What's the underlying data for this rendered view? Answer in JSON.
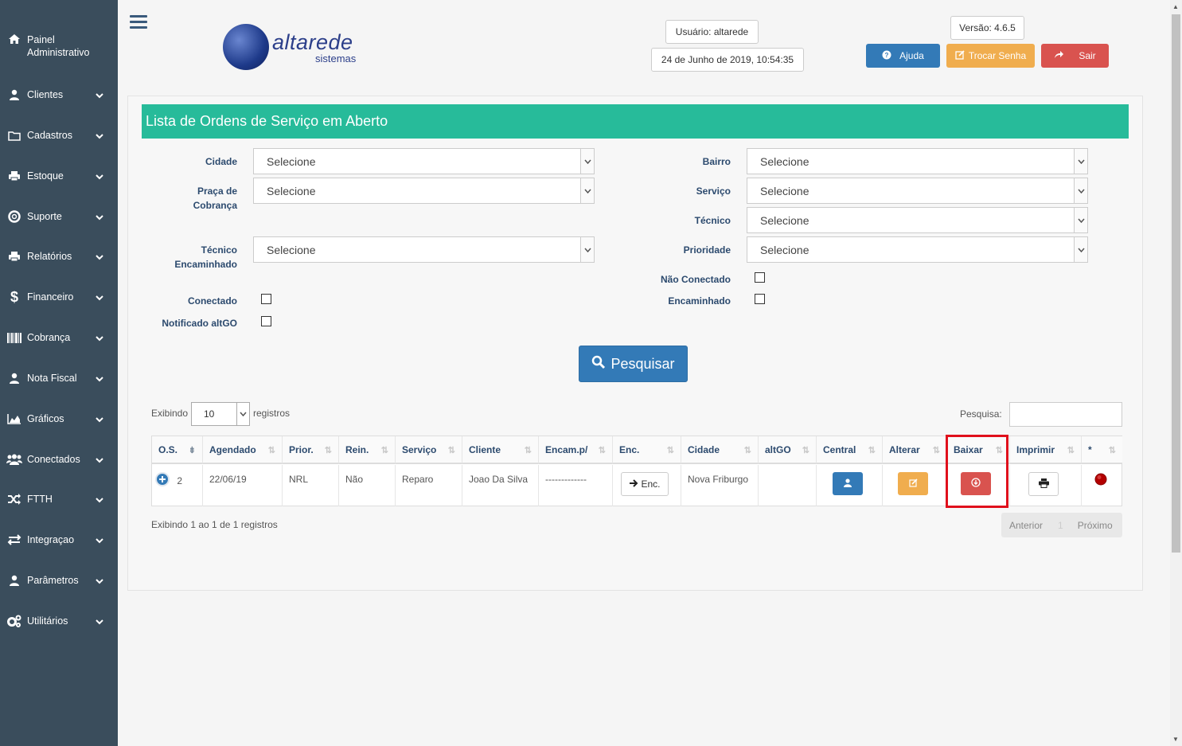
{
  "sidebar": {
    "items": [
      {
        "label": "Painel Administrativo",
        "icon": "home-icon"
      },
      {
        "label": "Clientes",
        "icon": "user-icon"
      },
      {
        "label": "Cadastros",
        "icon": "folder-icon"
      },
      {
        "label": "Estoque",
        "icon": "printer-icon"
      },
      {
        "label": "Suporte",
        "icon": "lifebuoy-icon"
      },
      {
        "label": "Relatórios",
        "icon": "printer-icon"
      },
      {
        "label": "Financeiro",
        "icon": "dollar-icon"
      },
      {
        "label": "Cobrança",
        "icon": "barcode-icon"
      },
      {
        "label": "Nota Fiscal",
        "icon": "user-icon"
      },
      {
        "label": "Gráficos",
        "icon": "area-chart-icon"
      },
      {
        "label": "Conectados",
        "icon": "users-icon"
      },
      {
        "label": "FTTH",
        "icon": "random-icon"
      },
      {
        "label": "Integraçao",
        "icon": "exchange-icon"
      },
      {
        "label": "Parâmetros",
        "icon": "user-icon"
      },
      {
        "label": "Utilitários",
        "icon": "cogs-icon"
      }
    ]
  },
  "header": {
    "logo_name": "altarede",
    "logo_sub": "sistemas",
    "user": "Usuário: altarede",
    "datetime": "24 de Junho de 2019, 10:54:35",
    "version": "Versão: 4.6.5",
    "help_label": "Ajuda",
    "change_password_label": "Trocar Senha",
    "logout_label": "Sair",
    "colors": {
      "help": "#337ab7",
      "change_password": "#f0ad4e",
      "logout": "#d9534f"
    }
  },
  "panel": {
    "title": "Lista de Ordens de Serviço em Aberto",
    "title_color": "#27bb9a"
  },
  "filters": {
    "cidade": {
      "label": "Cidade",
      "value": "Selecione"
    },
    "praca_line1": "Praça de",
    "praca_line2": "Cobrança",
    "praca": {
      "value": "Selecione"
    },
    "tecnico_enc_line1": "Técnico",
    "tecnico_enc_line2": "Encaminhado",
    "tecnico_enc": {
      "value": "Selecione"
    },
    "bairro": {
      "label": "Bairro",
      "value": "Selecione"
    },
    "servico": {
      "label": "Serviço",
      "value": "Selecione"
    },
    "tecnico": {
      "label": "Técnico",
      "value": "Selecione"
    },
    "prioridade": {
      "label": "Prioridade",
      "value": "Selecione"
    },
    "nao_conectado_label": "Não Conectado",
    "encaminhado_label": "Encaminhado",
    "conectado_label": "Conectado",
    "notificado_label": "Notificado altGO",
    "search_button": "Pesquisar"
  },
  "table_controls": {
    "showing_prefix": "Exibindo",
    "page_length": "10",
    "showing_suffix": "registros",
    "search_label": "Pesquisa:",
    "info": "Exibindo 1 ao 1 de 1 registros",
    "prev": "Anterior",
    "page": "1",
    "next": "Próximo"
  },
  "table": {
    "columns": [
      "O.S.",
      "Agendado",
      "Prior.",
      "Rein.",
      "Serviço",
      "Cliente",
      "Encam.p/",
      "Enc.",
      "Cidade",
      "altGO",
      "Central",
      "Alterar",
      "Baixar",
      "Imprimir",
      "*"
    ],
    "rows": [
      {
        "os": "2",
        "agendado": "22/06/19",
        "prior": "NRL",
        "rein": "Não",
        "servico": "Reparo",
        "cliente": "Joao Da Silva",
        "encam": "-------------",
        "enc_button": "Enc.",
        "cidade": "Nova Friburgo",
        "altgo": ""
      }
    ]
  }
}
